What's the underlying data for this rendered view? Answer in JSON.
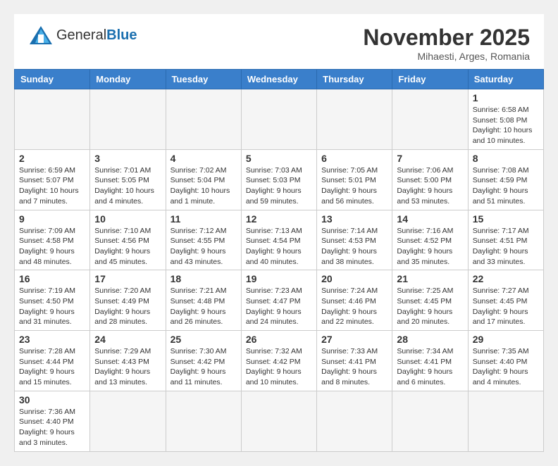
{
  "logo": {
    "general": "General",
    "blue": "Blue"
  },
  "header": {
    "title": "November 2025",
    "subtitle": "Mihaesti, Arges, Romania"
  },
  "weekdays": [
    "Sunday",
    "Monday",
    "Tuesday",
    "Wednesday",
    "Thursday",
    "Friday",
    "Saturday"
  ],
  "weeks": [
    [
      {
        "day": null
      },
      {
        "day": null
      },
      {
        "day": null
      },
      {
        "day": null
      },
      {
        "day": null
      },
      {
        "day": null
      },
      {
        "day": 1,
        "sunrise": "6:58 AM",
        "sunset": "5:08 PM",
        "daylight": "10 hours and 10 minutes."
      }
    ],
    [
      {
        "day": 2,
        "sunrise": "6:59 AM",
        "sunset": "5:07 PM",
        "daylight": "10 hours and 7 minutes."
      },
      {
        "day": 3,
        "sunrise": "7:01 AM",
        "sunset": "5:05 PM",
        "daylight": "10 hours and 4 minutes."
      },
      {
        "day": 4,
        "sunrise": "7:02 AM",
        "sunset": "5:04 PM",
        "daylight": "10 hours and 1 minute."
      },
      {
        "day": 5,
        "sunrise": "7:03 AM",
        "sunset": "5:03 PM",
        "daylight": "9 hours and 59 minutes."
      },
      {
        "day": 6,
        "sunrise": "7:05 AM",
        "sunset": "5:01 PM",
        "daylight": "9 hours and 56 minutes."
      },
      {
        "day": 7,
        "sunrise": "7:06 AM",
        "sunset": "5:00 PM",
        "daylight": "9 hours and 53 minutes."
      },
      {
        "day": 8,
        "sunrise": "7:08 AM",
        "sunset": "4:59 PM",
        "daylight": "9 hours and 51 minutes."
      }
    ],
    [
      {
        "day": 9,
        "sunrise": "7:09 AM",
        "sunset": "4:58 PM",
        "daylight": "9 hours and 48 minutes."
      },
      {
        "day": 10,
        "sunrise": "7:10 AM",
        "sunset": "4:56 PM",
        "daylight": "9 hours and 45 minutes."
      },
      {
        "day": 11,
        "sunrise": "7:12 AM",
        "sunset": "4:55 PM",
        "daylight": "9 hours and 43 minutes."
      },
      {
        "day": 12,
        "sunrise": "7:13 AM",
        "sunset": "4:54 PM",
        "daylight": "9 hours and 40 minutes."
      },
      {
        "day": 13,
        "sunrise": "7:14 AM",
        "sunset": "4:53 PM",
        "daylight": "9 hours and 38 minutes."
      },
      {
        "day": 14,
        "sunrise": "7:16 AM",
        "sunset": "4:52 PM",
        "daylight": "9 hours and 35 minutes."
      },
      {
        "day": 15,
        "sunrise": "7:17 AM",
        "sunset": "4:51 PM",
        "daylight": "9 hours and 33 minutes."
      }
    ],
    [
      {
        "day": 16,
        "sunrise": "7:19 AM",
        "sunset": "4:50 PM",
        "daylight": "9 hours and 31 minutes."
      },
      {
        "day": 17,
        "sunrise": "7:20 AM",
        "sunset": "4:49 PM",
        "daylight": "9 hours and 28 minutes."
      },
      {
        "day": 18,
        "sunrise": "7:21 AM",
        "sunset": "4:48 PM",
        "daylight": "9 hours and 26 minutes."
      },
      {
        "day": 19,
        "sunrise": "7:23 AM",
        "sunset": "4:47 PM",
        "daylight": "9 hours and 24 minutes."
      },
      {
        "day": 20,
        "sunrise": "7:24 AM",
        "sunset": "4:46 PM",
        "daylight": "9 hours and 22 minutes."
      },
      {
        "day": 21,
        "sunrise": "7:25 AM",
        "sunset": "4:45 PM",
        "daylight": "9 hours and 20 minutes."
      },
      {
        "day": 22,
        "sunrise": "7:27 AM",
        "sunset": "4:45 PM",
        "daylight": "9 hours and 17 minutes."
      }
    ],
    [
      {
        "day": 23,
        "sunrise": "7:28 AM",
        "sunset": "4:44 PM",
        "daylight": "9 hours and 15 minutes."
      },
      {
        "day": 24,
        "sunrise": "7:29 AM",
        "sunset": "4:43 PM",
        "daylight": "9 hours and 13 minutes."
      },
      {
        "day": 25,
        "sunrise": "7:30 AM",
        "sunset": "4:42 PM",
        "daylight": "9 hours and 11 minutes."
      },
      {
        "day": 26,
        "sunrise": "7:32 AM",
        "sunset": "4:42 PM",
        "daylight": "9 hours and 10 minutes."
      },
      {
        "day": 27,
        "sunrise": "7:33 AM",
        "sunset": "4:41 PM",
        "daylight": "9 hours and 8 minutes."
      },
      {
        "day": 28,
        "sunrise": "7:34 AM",
        "sunset": "4:41 PM",
        "daylight": "9 hours and 6 minutes."
      },
      {
        "day": 29,
        "sunrise": "7:35 AM",
        "sunset": "4:40 PM",
        "daylight": "9 hours and 4 minutes."
      }
    ],
    [
      {
        "day": 30,
        "sunrise": "7:36 AM",
        "sunset": "4:40 PM",
        "daylight": "9 hours and 3 minutes."
      },
      {
        "day": null
      },
      {
        "day": null
      },
      {
        "day": null
      },
      {
        "day": null
      },
      {
        "day": null
      },
      {
        "day": null
      }
    ]
  ]
}
